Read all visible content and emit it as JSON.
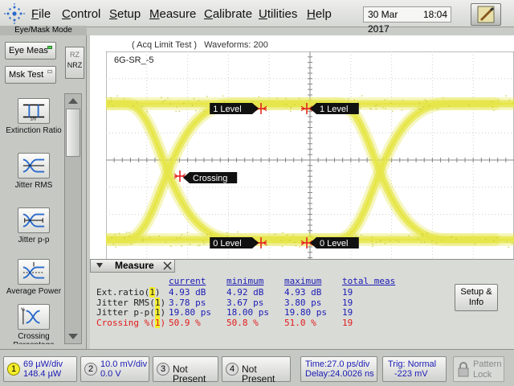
{
  "menu": {
    "items": [
      "File",
      "Control",
      "Setup",
      "Measure",
      "Calibrate",
      "Utilities",
      "Help"
    ],
    "underline": [
      "F",
      "C",
      "S",
      "M",
      "C",
      "U",
      "H"
    ],
    "date": "30 Mar 2017",
    "time": "18:04"
  },
  "left_panel": {
    "mode_title": "Eye/Mask Mode",
    "eye_meas": "Eye Meas",
    "mask_test": "Msk Test",
    "rz_label": "RZ",
    "nrz_label": "NRZ",
    "measurements": [
      {
        "label": "Extinction Ratio",
        "icon": "extinction-ratio-icon"
      },
      {
        "label": "Jitter RMS",
        "icon": "jitter-rms-icon"
      },
      {
        "label": "Jitter p-p",
        "icon": "jitter-pp-icon"
      },
      {
        "label": "Average Power",
        "icon": "average-power-icon"
      },
      {
        "label": "Crossing Percentage",
        "icon": "crossing-percentage-icon"
      }
    ]
  },
  "display": {
    "acq_status": "( Acq Limit Test )",
    "waveforms": "Waveforms: 200",
    "signal_name": "6G-SR_-5",
    "markers": {
      "one_level_left": "1 Level",
      "one_level_right": "1 Level",
      "crossing": "Crossing",
      "zero_level_left": "0 Level",
      "zero_level_right": "0 Level"
    },
    "trace_color": "#e6e64a",
    "marker_color": "#e21a1a"
  },
  "measure_panel": {
    "title": "Measure",
    "headers": [
      "current",
      "minimum",
      "maximum",
      "total meas"
    ],
    "rows": [
      {
        "name": "Ext.ratio(",
        "channel": "1",
        "close": ")",
        "current": "4.93 dB",
        "minimum": "4.92 dB",
        "maximum": "4.93 dB",
        "total": "19",
        "highlight": false
      },
      {
        "name": "Jitter RMS(",
        "channel": "1",
        "close": ")",
        "current": "3.78 ps",
        "minimum": "3.67 ps",
        "maximum": "3.80 ps",
        "total": "19",
        "highlight": false
      },
      {
        "name": "Jitter p-p(",
        "channel": "1",
        "close": ")",
        "current": "19.80 ps",
        "minimum": "18.00 ps",
        "maximum": "19.80 ps",
        "total": "19",
        "highlight": false
      },
      {
        "name": "Crossing %(",
        "channel": "1",
        "close": ")",
        "current": "50.9 %",
        "minimum": "50.8 %",
        "maximum": "51.0 %",
        "total": "19",
        "highlight": true
      }
    ],
    "setup_button": "Setup & Info"
  },
  "bottom_bar": {
    "ch1": {
      "num": "1",
      "scale": "69 µW/div",
      "offset": "148.4 µW"
    },
    "ch2": {
      "num": "2",
      "scale": "10.0 mV/div",
      "offset": "0.0 V"
    },
    "ch3": {
      "num": "3",
      "status": "Not Present"
    },
    "ch4": {
      "num": "4",
      "status": "Not Present"
    },
    "timebase": {
      "time": "Time:27.0 ps/div",
      "delay": "Delay:24.0026 ns"
    },
    "trigger": {
      "label": "Trig: Normal",
      "level": "-223 mV"
    },
    "pattern_lock": "Pattern Lock"
  }
}
